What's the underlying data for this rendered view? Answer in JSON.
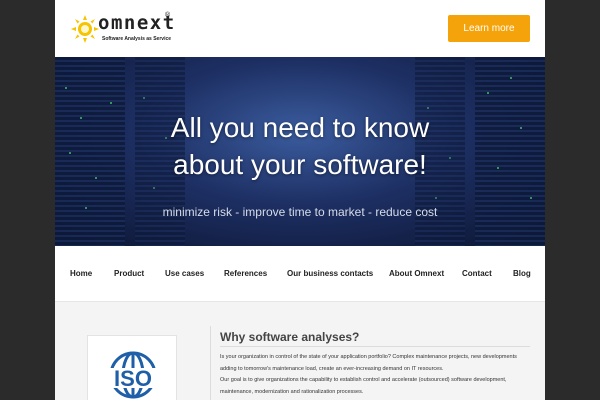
{
  "header": {
    "logo_word": "omnext",
    "logo_reg": "®",
    "logo_tagline": "Software Analysis as Service",
    "cta_label": "Learn more"
  },
  "hero": {
    "title_line1": "All you need to know",
    "title_line2": "about your software!",
    "subtitle": "minimize risk - improve time to market - reduce cost"
  },
  "nav": {
    "items": [
      "Home",
      "Product",
      "Use cases",
      "References",
      "Our business contacts",
      "About Omnext",
      "Contact",
      "Blog"
    ]
  },
  "content": {
    "badge_text": "ISO",
    "section_title": "Why software analyses?",
    "paragraphs": [
      "Is your organization in control of the state of your application portfolio? Complex maintenance projects, new developments adding to tomorrow's maintenance load, create an ever-increasing demand on IT resources.",
      "Our goal is to give organizations the capability to establish control and accelerate (outsourced) software development, maintenance, modernization and rationalization processes."
    ]
  },
  "colors": {
    "accent": "#f5a30a",
    "iso_blue": "#1e5fa8",
    "logo_yellow": "#f6c400"
  }
}
